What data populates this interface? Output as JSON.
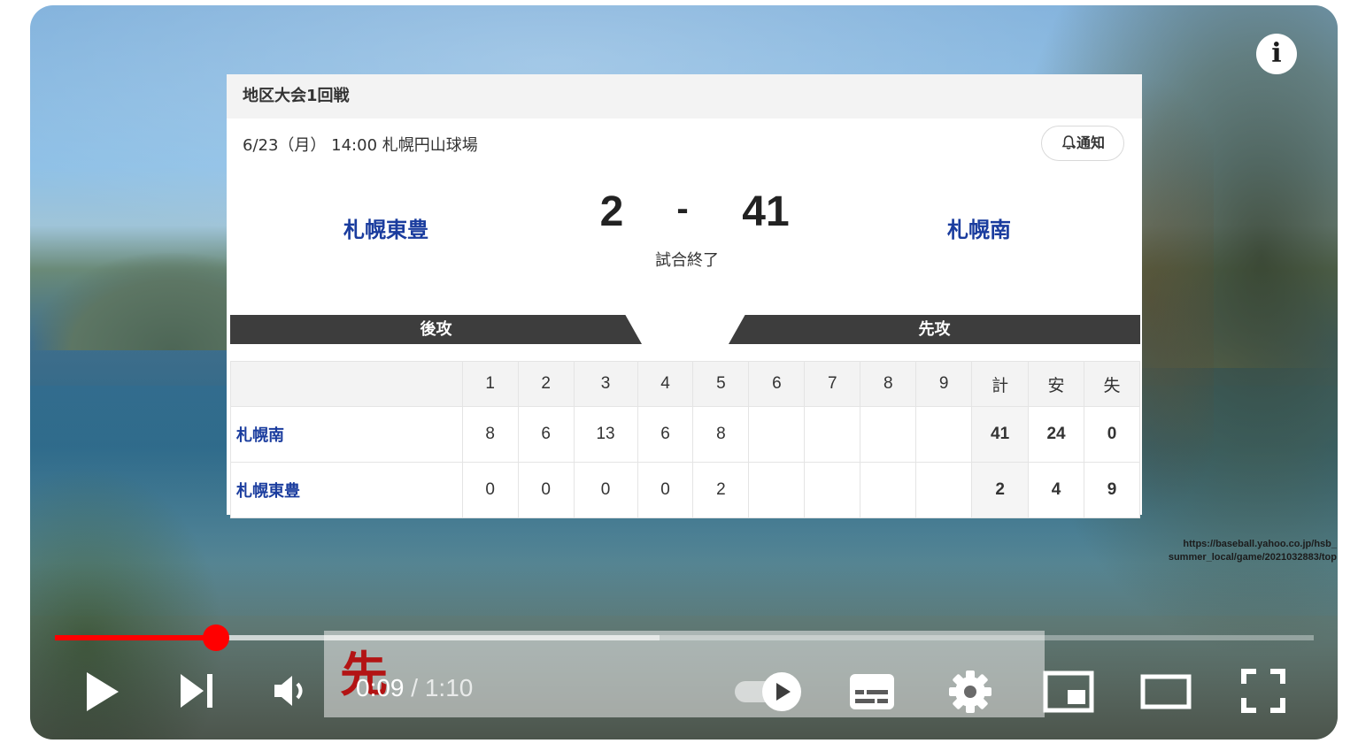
{
  "scorecard": {
    "round": "地区大会1回戦",
    "meta": "6/23（月） 14:00 札幌円山球場",
    "notify_label": "通知",
    "home_team": "札幌東豊",
    "away_team": "札幌南",
    "score_home": "2",
    "score_dash": "-",
    "score_away": "41",
    "status": "試合終了",
    "band_left": "後攻",
    "band_right": "先攻",
    "headers": [
      "",
      "1",
      "2",
      "3",
      "4",
      "5",
      "6",
      "7",
      "8",
      "9",
      "計",
      "安",
      "失"
    ],
    "rows": [
      {
        "team": "札幌南",
        "innings": [
          "8",
          "6",
          "13",
          "6",
          "8",
          "",
          "",
          "",
          ""
        ],
        "total": "41",
        "hits": "24",
        "errors": "0"
      },
      {
        "team": "札幌東豊",
        "innings": [
          "0",
          "0",
          "0",
          "0",
          "2",
          "",
          "",
          "",
          ""
        ],
        "total": "2",
        "hits": "4",
        "errors": "9"
      }
    ]
  },
  "source_url": "https://baseball.yahoo.co.jp/hsb_summer_local/game/2021032883/top",
  "source_url_lines": [
    "https://baseball.yahoo.co.jp/hsb_",
    "summer_local/game/2021032883/top"
  ],
  "caption_char": "先",
  "player": {
    "info_icon": "i",
    "time_current": "0:09",
    "time_sep": "/",
    "time_total": "1:10",
    "progress_played": 0.128,
    "progress_buffered": 0.48,
    "accent": "#ff0000",
    "icons": [
      "play-icon",
      "next-icon",
      "volume-icon",
      "autoplay-toggle-icon",
      "subtitles-icon",
      "settings-icon",
      "miniplayer-icon",
      "theater-icon",
      "fullscreen-icon"
    ]
  }
}
